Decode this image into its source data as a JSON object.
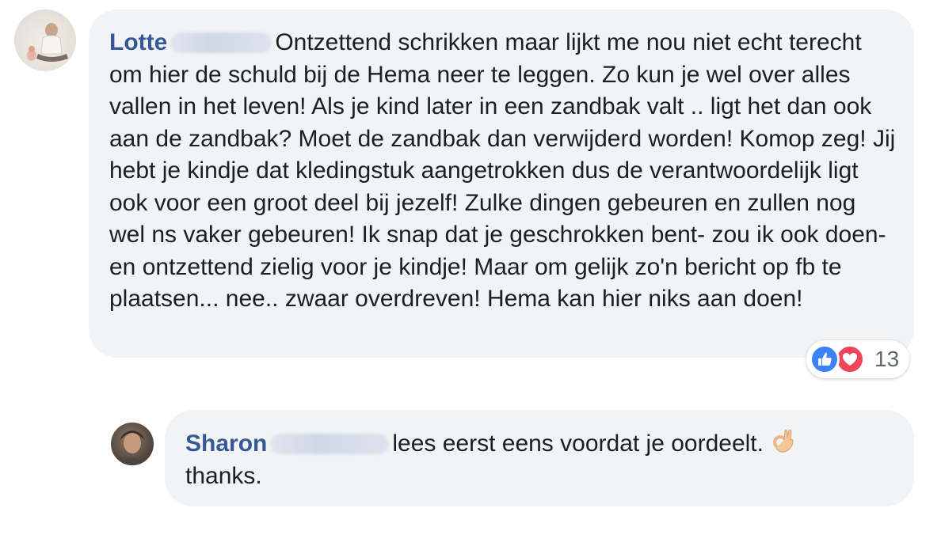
{
  "comments": [
    {
      "author": "Lotte",
      "text": "Ontzettend schrikken maar lijkt me nou niet echt terecht om hier de schuld bij de Hema neer te leggen. Zo kun je wel over alles vallen in het leven! Als je kind later in een zandbak valt .. ligt het dan ook aan de zandbak? Moet de zandbak dan verwijderd worden! Komop zeg! Jij hebt je kindje dat kledingstuk aangetrokken dus de verantwoordelijk ligt ook voor een groot deel bij jezelf! Zulke dingen gebeuren en zullen nog wel ns vaker gebeuren! Ik snap dat je geschrokken bent- zou ik ook doen- en ontzettend zielig voor je kindje! Maar om gelijk zo'n bericht op fb te plaatsen... nee.. zwaar overdreven! Hema kan hier niks aan doen!",
      "reactions": {
        "count": "13",
        "icons": [
          "like-icon",
          "love-icon"
        ],
        "like_color": "#3b82f6",
        "love_color": "#f0445a"
      }
    },
    {
      "author": "Sharon",
      "text": "lees eerst eens voordat je oordeelt.",
      "text_after_emoji": "thanks.",
      "emoji": "ok-hand-icon"
    }
  ],
  "colors": {
    "author": "#365899",
    "bubble": "#f2f3f5",
    "text": "#1c1e21"
  }
}
